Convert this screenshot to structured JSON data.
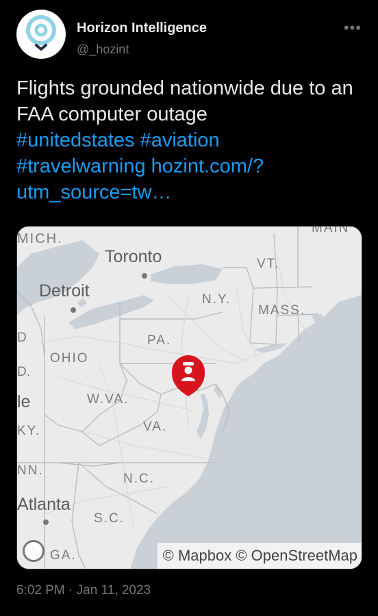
{
  "author": {
    "name": "Horizon Intelligence",
    "handle": "@_hozint",
    "avatar_icon": "location-pin-logo"
  },
  "more_icon": "more-options-icon",
  "tweet": {
    "text": "Flights grounded nationwide due to an FAA computer outage",
    "links": [
      "#unitedstates",
      "#aviation",
      "#travelwarning",
      "hozint.com/?utm_source=tw…"
    ]
  },
  "map": {
    "labels": {
      "mich": "MICH.",
      "toronto": "Toronto",
      "vt": "VT.",
      "detroit": "Detroit",
      "ny": "N.Y.",
      "mass": "MASS.",
      "pa": "PA.",
      "ohio": "OHIO",
      "wva": "W.VA.",
      "va": "VA.",
      "nc": "N.C.",
      "atlanta": "Atlanta",
      "sc": "S.C.",
      "ga": "GA.",
      "ky": "KY.",
      "tn": "NN.",
      "le": "le",
      "d_edge": "D",
      "d_edge2": "D.",
      "maine": "MAIN"
    },
    "attribution": "© Mapbox © OpenStreetMap",
    "marker_icon": "person-alert-marker-icon",
    "colors": {
      "water": "#c9d0d6",
      "land": "#ebebeb",
      "marker": "#d7141e"
    }
  },
  "timestamp": "6:02 PM · Jan 11, 2023"
}
